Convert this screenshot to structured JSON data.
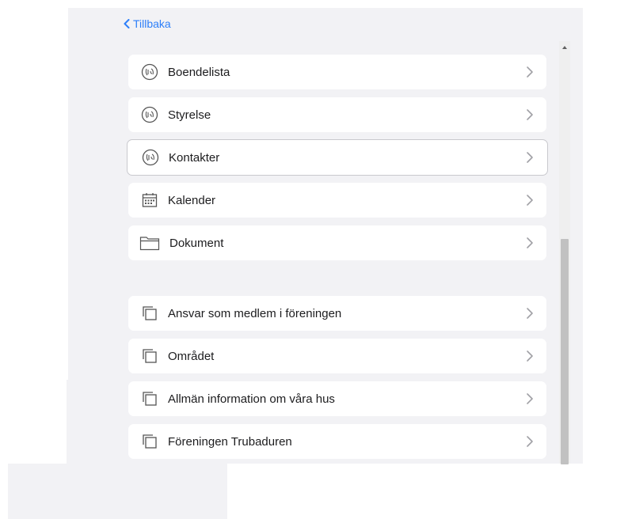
{
  "navigation": {
    "back_label": "Tillbaka"
  },
  "menu_group_1": [
    {
      "label": "Boendelista",
      "icon": "association-logo-icon"
    },
    {
      "label": "Styrelse",
      "icon": "association-logo-icon"
    },
    {
      "label": "Kontakter",
      "icon": "association-logo-icon",
      "selected": true
    },
    {
      "label": "Kalender",
      "icon": "calendar-icon"
    },
    {
      "label": "Dokument",
      "icon": "folder-icon"
    }
  ],
  "menu_group_2": [
    {
      "label": "Ansvar som medlem i föreningen",
      "icon": "pages-icon"
    },
    {
      "label": "Området",
      "icon": "pages-icon"
    },
    {
      "label": "Allmän information om våra hus",
      "icon": "pages-icon"
    },
    {
      "label": "Föreningen Trubaduren",
      "icon": "pages-icon"
    }
  ],
  "colors": {
    "accent": "#2d7ff9",
    "panel_background": "#f2f2f5",
    "row_background": "#ffffff",
    "text": "#1c1c1e",
    "chevron": "#a0a0a5",
    "icon": "#555555"
  }
}
